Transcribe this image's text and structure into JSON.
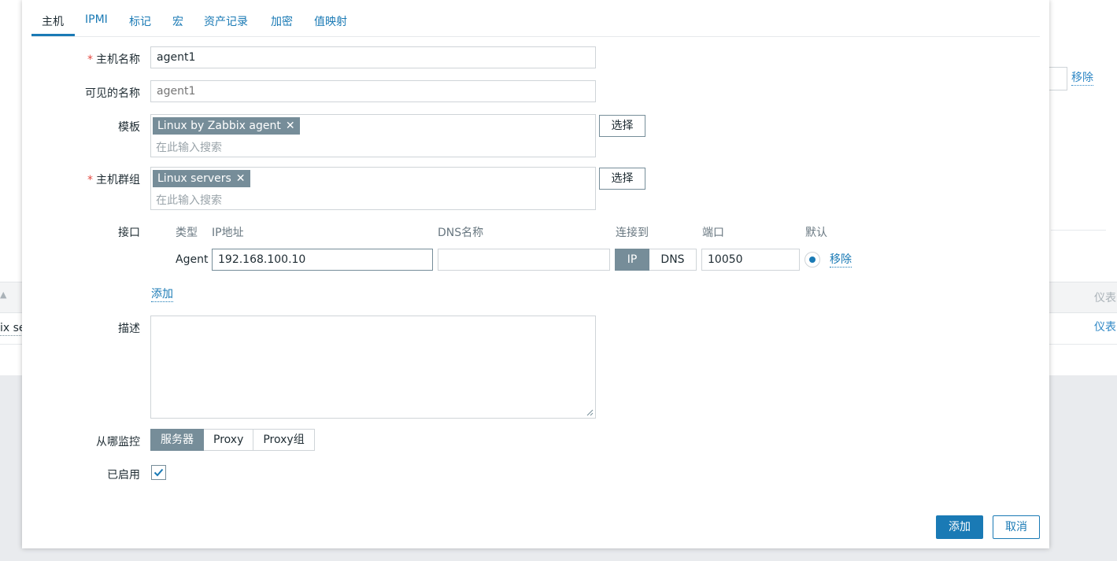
{
  "background": {
    "remove_link": "移除",
    "dashboard_header": "仪表",
    "dashboard_link": "仪表",
    "truncated_text": "ix se",
    "sort_icon": "triangle-up"
  },
  "tabs": [
    "主机",
    "IPMI",
    "标记",
    "宏",
    "资产记录",
    "加密",
    "值映射"
  ],
  "form": {
    "host_name": {
      "label": "主机名称",
      "value": "agent1",
      "required": true
    },
    "visible_name": {
      "label": "可见的名称",
      "placeholder": "agent1"
    },
    "templates": {
      "label": "模板",
      "chip": "Linux by Zabbix agent",
      "placeholder": "在此输入搜索",
      "select_label": "选择"
    },
    "host_groups": {
      "label": "主机群组",
      "chip": "Linux servers",
      "placeholder": "在此输入搜索",
      "select_label": "选择",
      "required": true
    },
    "interfaces": {
      "label": "接口",
      "headers": {
        "type": "类型",
        "ip": "IP地址",
        "dns": "DNS名称",
        "connect": "连接到",
        "port": "端口",
        "default": "默认"
      },
      "row": {
        "type": "Agent",
        "ip": "192.168.100.10",
        "dns": "",
        "connect_ip": "IP",
        "connect_dns": "DNS",
        "connect_selected": "IP",
        "port": "10050",
        "remove": "移除"
      },
      "add_link": "添加"
    },
    "description": {
      "label": "描述",
      "value": ""
    },
    "monitored_by": {
      "label": "从哪监控",
      "options": [
        "服务器",
        "Proxy",
        "Proxy组"
      ],
      "selected": "服务器"
    },
    "enabled": {
      "label": "已启用",
      "checked": true
    }
  },
  "footer": {
    "add_label": "添加",
    "cancel_label": "取消"
  },
  "colors": {
    "accent": "#1a7ab5",
    "chip": "#768d99",
    "required": "#e44a42"
  }
}
